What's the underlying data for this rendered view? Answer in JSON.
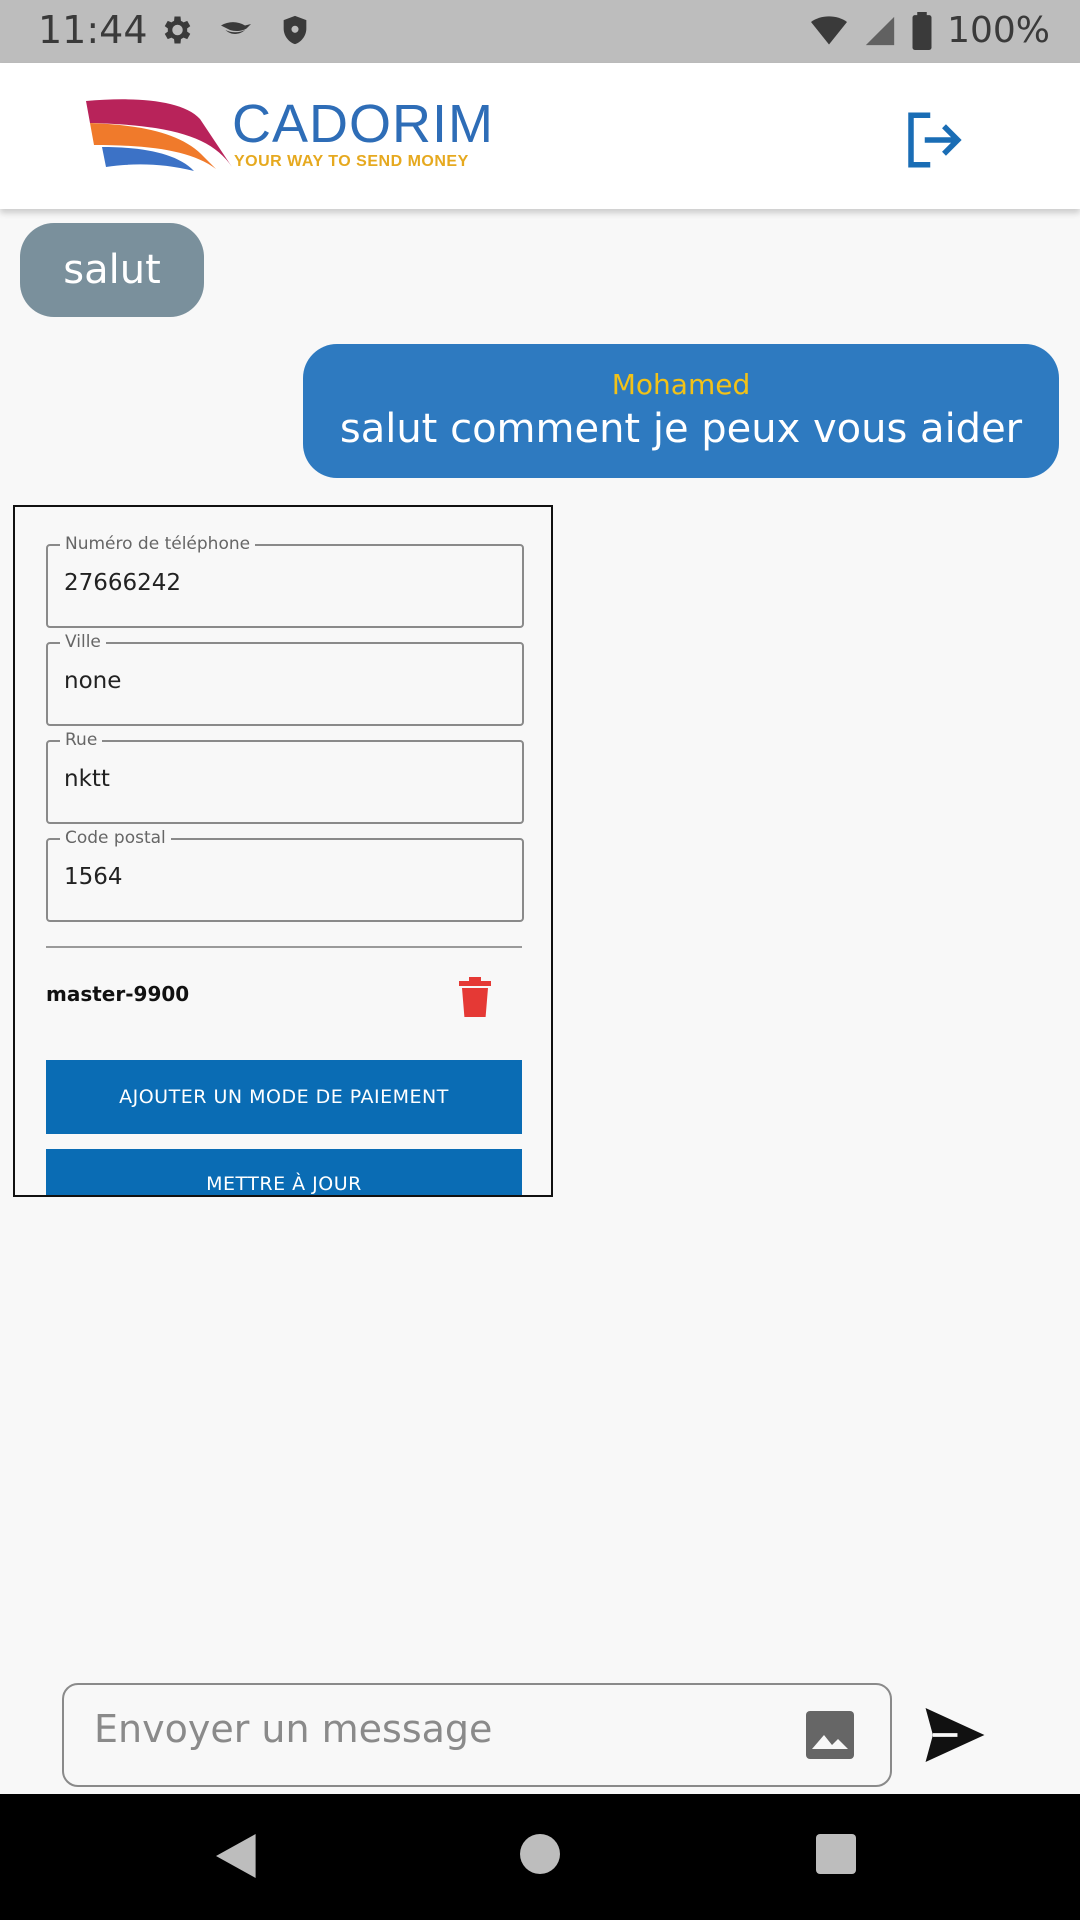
{
  "status_bar": {
    "time": "11:44",
    "battery": "100%",
    "icons": [
      "settings-icon",
      "bird-icon",
      "shield-icon",
      "wifi-icon",
      "signal-icon",
      "battery-icon"
    ]
  },
  "header": {
    "logo_name": "CADORIM",
    "logo_tagline": "YOUR WAY TO SEND MONEY",
    "logout_icon": "logout-icon",
    "brand_color": "#2e6db7"
  },
  "chat": {
    "incoming_message": "salut",
    "outgoing_sender": "Mohamed",
    "outgoing_message": "salut comment je peux vous aider"
  },
  "form": {
    "fields": [
      {
        "label": "Numéro de téléphone",
        "value": "27666242"
      },
      {
        "label": "Ville",
        "value": "none"
      },
      {
        "label": "Rue",
        "value": "nktt"
      },
      {
        "label": "Code postal",
        "value": "1564"
      }
    ],
    "payment_method": "master-9900",
    "add_payment_label": "AJOUTER UN MODE DE PAIEMENT",
    "update_label": "METTRE À JOUR"
  },
  "composer": {
    "placeholder": "Envoyer un message",
    "image_icon": "image-icon",
    "send_icon": "send-icon"
  },
  "colors": {
    "incoming_bubble": "#7a909c",
    "outgoing_bubble": "#2e7ac0",
    "sender_name": "#f2c218",
    "button": "#0a6cb4",
    "delete": "#e53935"
  }
}
